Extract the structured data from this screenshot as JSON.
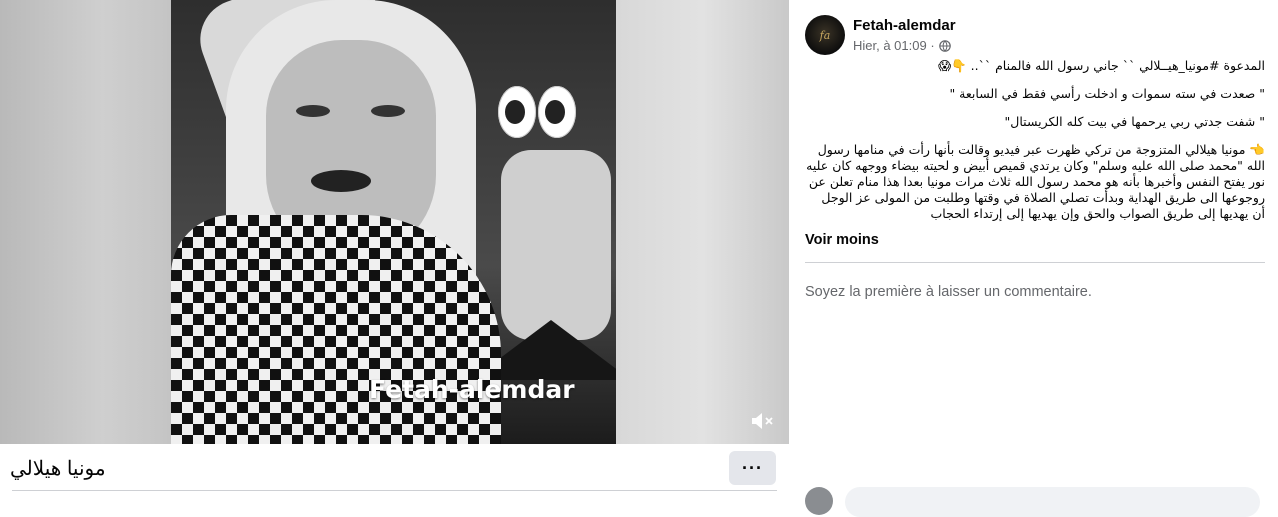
{
  "video": {
    "watermark": "Fetah-alemdar",
    "overlay_emoji": "eyes-emoji",
    "mute_icon": "speaker-muted-icon"
  },
  "caption": {
    "title": "مونيا هيلالي",
    "more_label": "···"
  },
  "post": {
    "page_name": "Fetah-alemdar",
    "timestamp": "Hier, à 01:09 ·",
    "privacy_icon": "globe-icon",
    "text_lines": [
      "المدعوة #مونيا_هيــلالي `` جاني رسول الله فالمنام ``.. 👇😱",
      "\" صعدت في سته سموات و ادخلت رأسي فقط في السابعة \"",
      "\" شفت جدتي ربي يرحمها في بيت كله الكريستال\"",
      "👈 مونيا هيلالي المتزوجة من تركي ظهرت عبر فيديو وقالت بأنها رأت في منامها رسول الله \"محمد صلى الله عليه وسلم\" وكان يرتدي قميص أبيض و لحيته بيضاء ووجهه كان عليه نور يفتح النفس وأخبرها بأنه هو محمد رسول الله ثلاث مرات مونيا بعدا هذا منام تعلن عن روجوعها الى طريق الهداية وبدأت تصلي الصلاة في وقتها وطلبت من المولى عز الوجل أن يهديها إلى طريق الصواب والحق وإن يهديها إلى إرتداء الحجاب"
    ],
    "see_less": "Voir moins",
    "comment_hint": "Soyez la première à laisser un commentaire."
  }
}
